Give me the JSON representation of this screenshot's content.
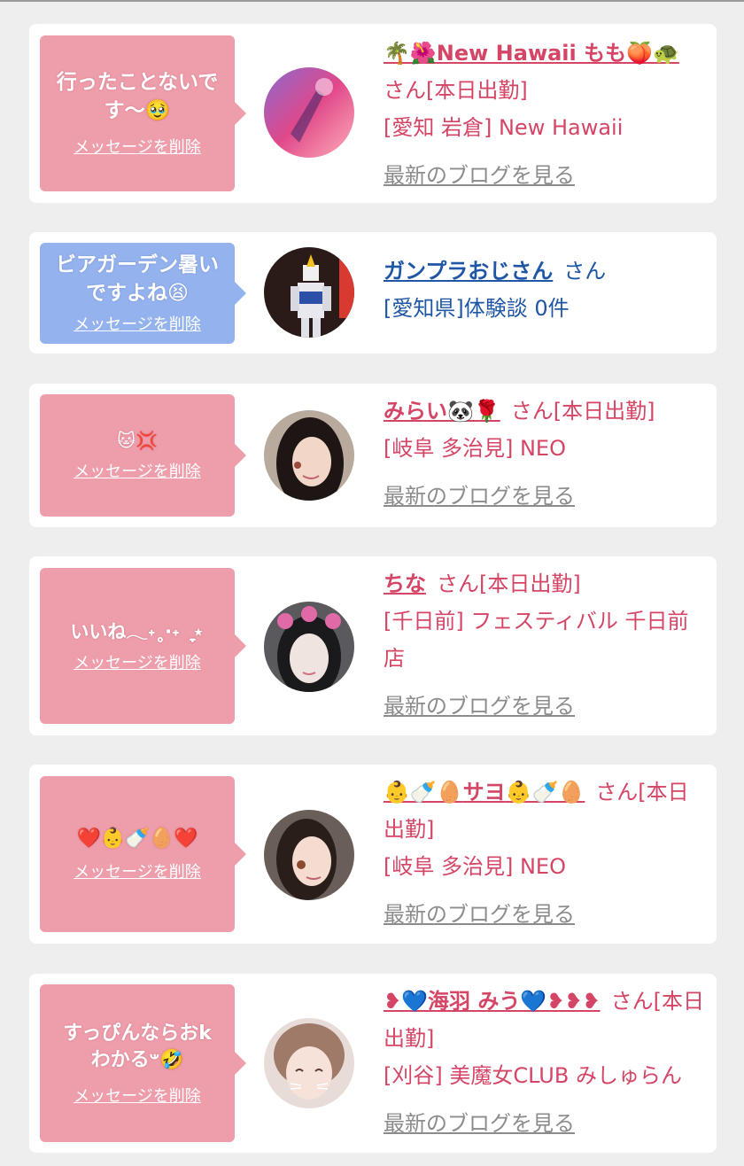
{
  "delete_label": "メッセージを削除",
  "blog_label": "最新のブログを見る",
  "cards": [
    {
      "message": "行ったことないで\nす〜🥹",
      "name_prefix": "🌴🌺",
      "name": "New Hawaii もも",
      "name_suffix": "🍑🐢",
      "san": "さん[本日出勤]",
      "area": "[愛知 岩倉] New Hawaii"
    },
    {
      "message": "ビアガーデン暑い\nですよね😫",
      "name": "ガンプラおじさん",
      "san": "さん",
      "area": "[愛知県]体験談 0件"
    },
    {
      "message": "🐱💢",
      "name": "みらい",
      "name_suffix": "🐼🌹",
      "san": "さん[本日出勤]",
      "area": "[岐阜 多治見] NEO"
    },
    {
      "message": "いいね𓂃˖˳·˖ ִֶָ ⋆",
      "name": "ちな",
      "san": "さん[本日出勤]",
      "area": "[千日前] フェスティバル 千日前店"
    },
    {
      "message": "❤️👶🍼🥚❤️",
      "name_prefix": "👶🍼🥚",
      "name": "サヨ",
      "name_suffix": "👶🍼🥚",
      "san": "さん[本日出勤]",
      "area": "[岐阜 多治見] NEO"
    },
    {
      "message": "すっぴんならおk\nわかる𐤔🤣",
      "name_prefix": "❥💙",
      "name": "海羽 みう",
      "name_suffix": "💙❥❥❥",
      "san": "さん[本日出勤]",
      "area": "[刈谷] 美魔女CLUB みしゅらん"
    }
  ],
  "colors": {
    "accent_pink": "#d44566",
    "bubble_pink": "#ee9dab",
    "bubble_blue": "#94b3ee",
    "link_blue": "#1f57a6"
  }
}
